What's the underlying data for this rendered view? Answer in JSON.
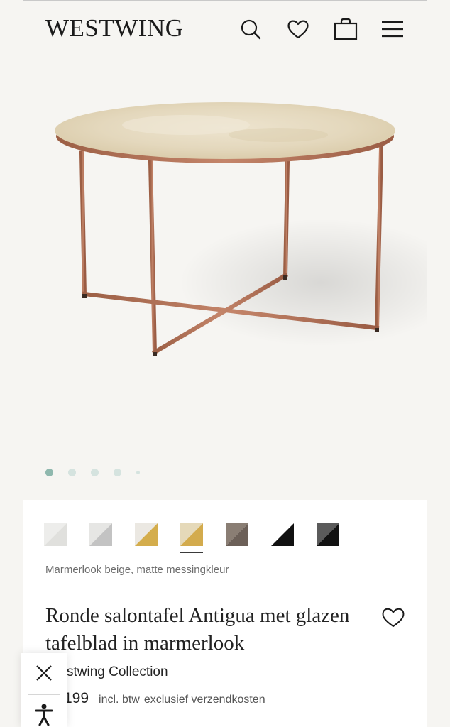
{
  "header": {
    "logo": "WESTWING",
    "icons": [
      "search-icon",
      "heart-icon",
      "shopping-bag-icon",
      "menu-icon"
    ]
  },
  "gallery": {
    "image": "round-coffee-table-marble-top-copper-frame",
    "slides_total": 5,
    "active_slide": 1
  },
  "swatches": {
    "selected_index": 3,
    "items": [
      {
        "a": "#ededeb",
        "b": "#e0e0dd"
      },
      {
        "a": "#e6e6e4",
        "b": "#c3c3c3"
      },
      {
        "a": "#ebe8e2",
        "b": "#d4ad4c"
      },
      {
        "a": "#e5d9b9",
        "b": "#d3ab4d"
      },
      {
        "a": "#8a7e74",
        "b": "#6c6058"
      },
      {
        "a": "#ffffff",
        "b": "#111111"
      },
      {
        "a": "#5b5b5b",
        "b": "#121212"
      }
    ]
  },
  "product": {
    "variant_label": "Marmerlook beige, matte messingkleur",
    "title": "Ronde salontafel Antigua met glazen tafelblad in marmerlook",
    "brand": "stwing Collection",
    "price": "199",
    "vat_note": "incl. btw",
    "shipping_link": "exclusief verzendkosten"
  },
  "colors": {
    "copper": "#b0745a",
    "marble": "#e8ddc4",
    "dot_active": "#8fb8ae",
    "dot_inactive": "#d5e3df"
  }
}
